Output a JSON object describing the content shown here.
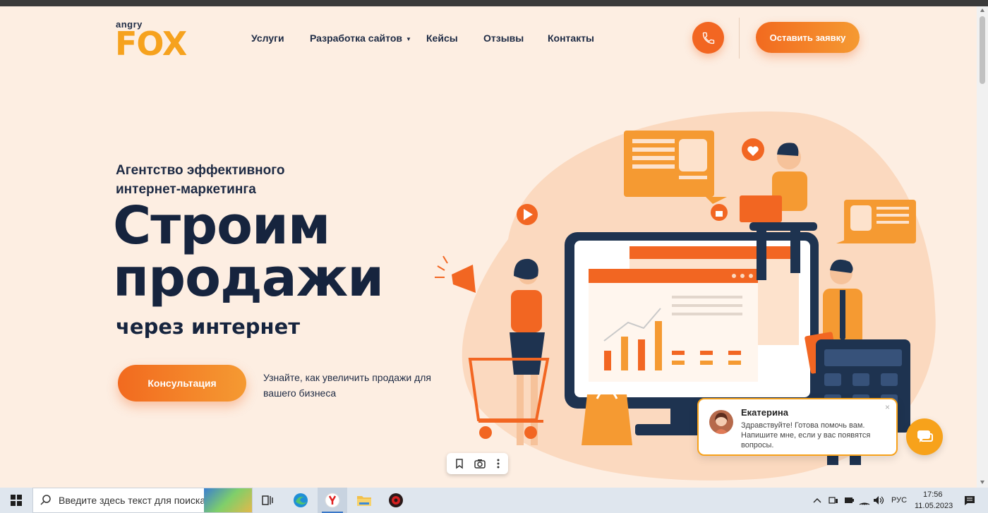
{
  "header": {
    "logo_small": "angry",
    "logo_big": "FOX",
    "nav": [
      {
        "label": "Услуги"
      },
      {
        "label": "Разработка сайтов",
        "dropdown": true
      },
      {
        "label": "Кейсы"
      },
      {
        "label": "Отзывы"
      },
      {
        "label": "Контакты"
      }
    ],
    "cta_label": "Оставить заявку",
    "phone_icon": "phone-icon"
  },
  "hero": {
    "subtitle": "Агентство эффективного интернет-маркетинга",
    "headline": "Строим продажи",
    "headline2": "через интернет",
    "consult_label": "Консультация",
    "consult_note": "Узнайте, как увеличить продажи для вашего бизнеса"
  },
  "chat": {
    "name": "Екатерина",
    "message": "Здравствуйте! Готова помочь вам. Напишите мне, если у вас появятся вопросы.",
    "close_glyph": "×"
  },
  "taskbar": {
    "search_placeholder": "Введите здесь текст для поиска",
    "lang": "РУС",
    "time": "17:56",
    "date": "11.05.2023"
  },
  "colors": {
    "accent": "#f26622",
    "accent2": "#f59a32",
    "navy": "#16243e",
    "background": "#fdeee2"
  }
}
